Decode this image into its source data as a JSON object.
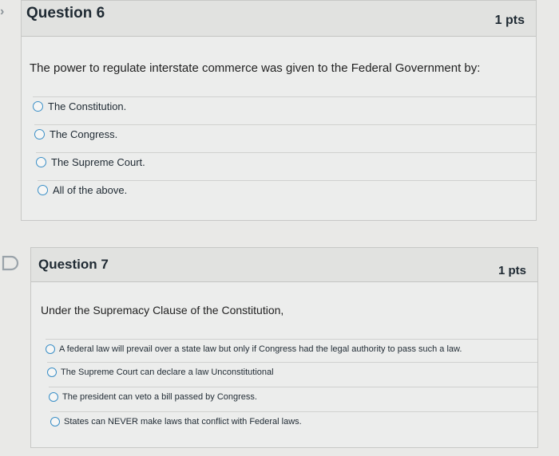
{
  "q6": {
    "title": "Question 6",
    "points": "1 pts",
    "prompt": "The power to regulate interstate commerce was given to the Federal Government by:",
    "answers": [
      "The Constitution.",
      "The Congress.",
      "The Supreme Court.",
      "All of the above."
    ]
  },
  "q7": {
    "title": "Question 7",
    "points": "1 pts",
    "prompt": "Under the Supremacy Clause of the Constitution,",
    "answers": [
      "A federal law will prevail over a state law but only if Congress had the legal authority to pass such a law.",
      "The Supreme Court can declare a law Unconstitutional",
      "The president can veto a bill passed by Congress.",
      "States can NEVER make laws that conflict with Federal laws."
    ]
  },
  "icons": {
    "q6_marker": "chevron-right-icon",
    "q7_marker": "flag-icon"
  }
}
